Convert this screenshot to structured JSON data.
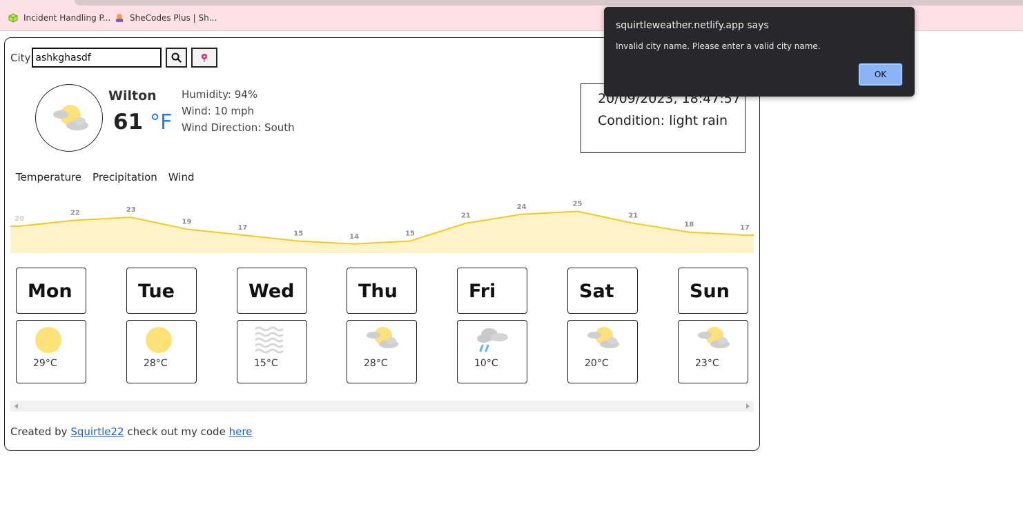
{
  "bookmarks": [
    {
      "label": "Incident Handling P..."
    },
    {
      "label": "SheCodes Plus | Sh..."
    }
  ],
  "search": {
    "city_label": "City",
    "value": "ashkghasdf"
  },
  "current": {
    "icon": "partly-cloudy-icon",
    "city": "Wilton",
    "temperature": "61",
    "unit": "°F",
    "humidity": "Humidity: 94%",
    "wind": "Wind: 10 mph",
    "wind_direction": "Wind Direction: South",
    "datetime": "20/09/2023, 18:47:57",
    "condition": "Condition: light rain"
  },
  "tabs": [
    {
      "label": "Temperature"
    },
    {
      "label": "Precipitation"
    },
    {
      "label": "Wind"
    }
  ],
  "chart_data": {
    "type": "area",
    "x": [
      0,
      1,
      2,
      3,
      4,
      5,
      6,
      7,
      8,
      9,
      10,
      11,
      12,
      13
    ],
    "values": [
      20,
      22,
      23,
      19,
      17,
      15,
      14,
      15,
      21,
      24,
      25,
      21,
      18,
      17
    ],
    "labels": [
      "20",
      "22",
      "23",
      "19",
      "17",
      "15",
      "14",
      "15",
      "21",
      "24",
      "25",
      "21",
      "18",
      "17"
    ],
    "line_color": "#f7c91b",
    "fill_color": "#fdf3c8"
  },
  "forecast": [
    {
      "day": "Mon",
      "icon": "sun-icon",
      "temp": "29°C"
    },
    {
      "day": "Tue",
      "icon": "sun-icon",
      "temp": "28°C"
    },
    {
      "day": "Wed",
      "icon": "mist-icon",
      "temp": "15°C"
    },
    {
      "day": "Thu",
      "icon": "partly-cloudy-icon",
      "temp": "28°C"
    },
    {
      "day": "Fri",
      "icon": "rain-icon",
      "temp": "10°C"
    },
    {
      "day": "Sat",
      "icon": "partly-cloudy-icon",
      "temp": "20°C"
    },
    {
      "day": "Sun",
      "icon": "partly-cloudy-icon",
      "temp": "23°C"
    }
  ],
  "footer": {
    "prefix": "Created by",
    "author_link": "Squirtle22",
    "middle": "check out my code",
    "code_link": "here"
  },
  "dialog": {
    "title": "squirtleweather.netlify.app says",
    "message": "Invalid city name. Please enter a valid city name.",
    "ok_label": "OK"
  }
}
